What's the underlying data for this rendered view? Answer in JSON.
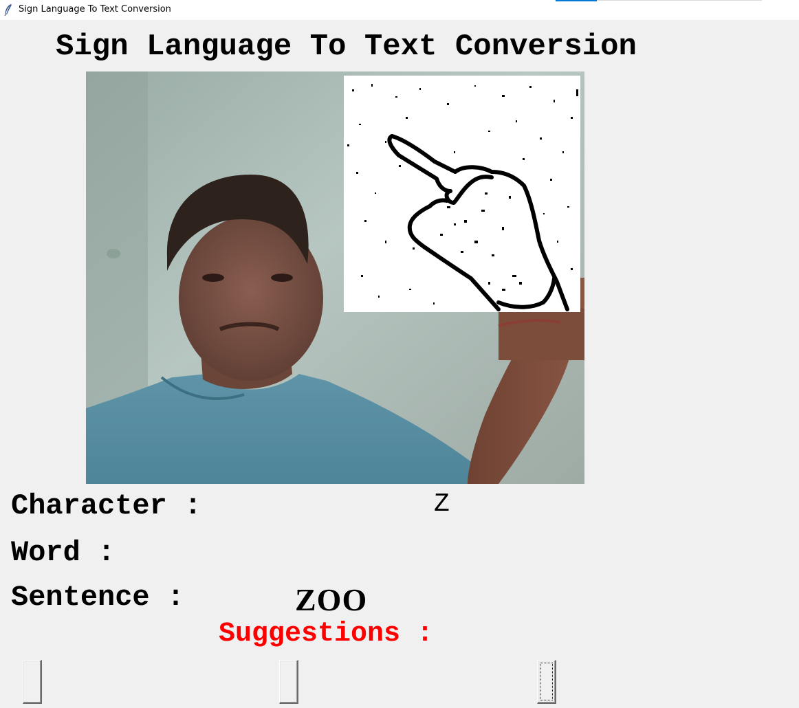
{
  "window": {
    "title": "Sign Language To Text Conversion",
    "icon": "feather-icon"
  },
  "heading": "Sign Language To Text Conversion",
  "camera_feed": {
    "description_icon": "webcam-feed",
    "processed_panel_icon": "hand-edge-map"
  },
  "labels": {
    "character": "Character :",
    "word": "Word :",
    "sentence": "Sentence :",
    "suggestions": "Suggestions :"
  },
  "values": {
    "character": "Z",
    "word": "",
    "sentence": "ZOO"
  },
  "suggestion_buttons": [
    "",
    "",
    ""
  ],
  "colors": {
    "background": "#f0f0f0",
    "suggestions_label": "#ff0000",
    "text": "#000000"
  }
}
